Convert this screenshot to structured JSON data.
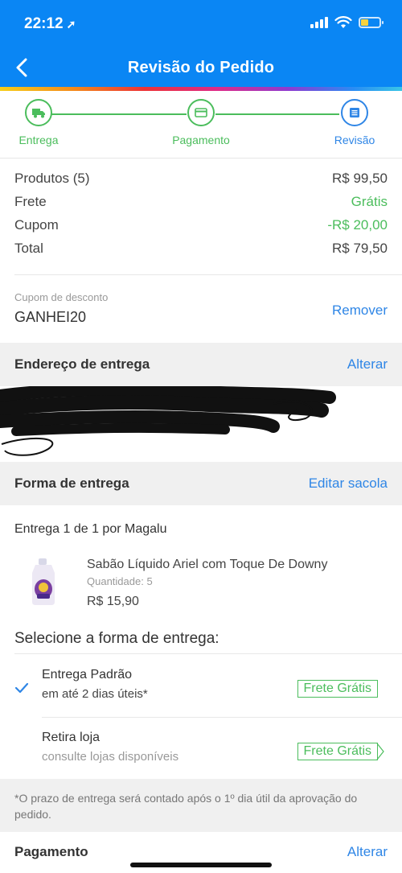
{
  "status_bar": {
    "time": "22:12"
  },
  "header": {
    "title": "Revisão do Pedido"
  },
  "stepper": {
    "steps": [
      {
        "label": "Entrega"
      },
      {
        "label": "Pagamento"
      },
      {
        "label": "Revisão"
      }
    ]
  },
  "summary": {
    "rows": [
      {
        "label": "Produtos (5)",
        "value": "R$ 99,50"
      },
      {
        "label": "Frete",
        "value": "Grátis"
      },
      {
        "label": "Cupom",
        "value": "-R$ 20,00"
      },
      {
        "label": "Total",
        "value": "R$ 79,50"
      }
    ]
  },
  "coupon": {
    "label": "Cupom de desconto",
    "code": "GANHEI20",
    "action": "Remover"
  },
  "address_section": {
    "title": "Endereço de entrega",
    "action": "Alterar"
  },
  "delivery_section": {
    "title": "Forma de entrega",
    "action": "Editar sacola"
  },
  "shipment": {
    "title": "Entrega 1 de 1 por Magalu"
  },
  "product": {
    "name": "Sabão Líquido Ariel com Toque De Downy",
    "quantity": "Quantidade: 5",
    "price": "R$ 15,90"
  },
  "delivery_options": {
    "title": "Selecione a forma de entrega:",
    "options": [
      {
        "name": "Entrega Padrão",
        "detail": "em até 2 dias úteis*",
        "badge": "Frete Grátis",
        "selected": true
      },
      {
        "name": "Retira loja",
        "detail": "consulte lojas disponíveis",
        "badge": "Frete Grátis",
        "selected": false
      }
    ]
  },
  "note": "*O prazo de entrega será contado após o 1º dia útil da aprovação do pedido.",
  "payment_section": {
    "title": "Pagamento",
    "action": "Alterar"
  },
  "colors": {
    "header_blue": "#0a86f4",
    "success_green": "#4bbd5c",
    "link_blue": "#2f86e6"
  }
}
